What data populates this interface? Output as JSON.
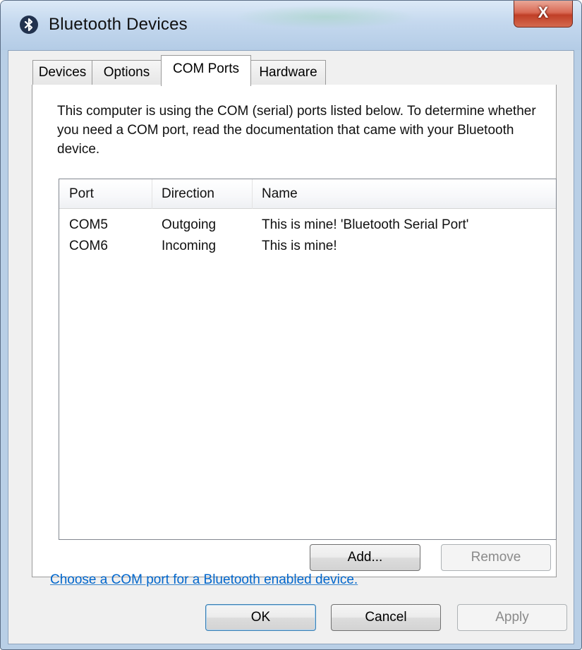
{
  "window": {
    "title": "Bluetooth Devices",
    "close_label": "X",
    "bluetooth_icon": "bluetooth-icon"
  },
  "tabs": [
    {
      "label": "Devices",
      "active": false
    },
    {
      "label": "Options",
      "active": false
    },
    {
      "label": "COM Ports",
      "active": true
    },
    {
      "label": "Hardware",
      "active": false
    }
  ],
  "com_ports": {
    "description": "This computer is using the COM (serial) ports listed below. To determine whether you need a COM port, read the documentation that came with your Bluetooth device.",
    "columns": [
      "Port",
      "Direction",
      "Name"
    ],
    "rows": [
      {
        "port": "COM5",
        "direction": "Outgoing",
        "name": "This is mine! 'Bluetooth Serial Port'"
      },
      {
        "port": "COM6",
        "direction": "Incoming",
        "name": "This is mine!"
      }
    ],
    "add_button": "Add...",
    "remove_button": "Remove",
    "link_text": "Choose a COM port for a Bluetooth enabled device."
  },
  "footer": {
    "ok": "OK",
    "cancel": "Cancel",
    "apply": "Apply"
  },
  "colors": {
    "accent": "#0066cc",
    "close": "#c03f27"
  }
}
